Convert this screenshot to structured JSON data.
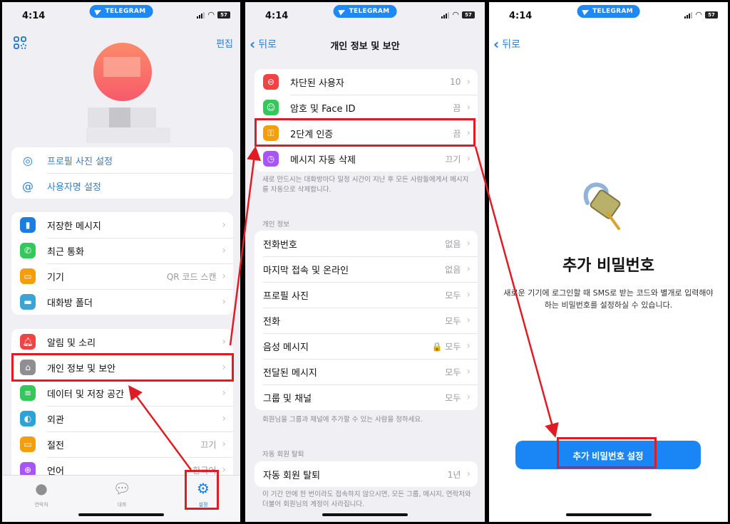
{
  "status_bar": {
    "time": "4:14",
    "pill_label": "TELEGRAM",
    "battery": "57"
  },
  "panel1": {
    "edit_label": "편집",
    "profile_actions": [
      {
        "icon": "camera-add-icon",
        "label": "프로필 사진 설정"
      },
      {
        "icon": "at-sign-add-icon",
        "label": "사용자명 설정"
      }
    ],
    "group1": [
      {
        "icon": "bookmark-icon",
        "color": "#1c7de0",
        "label": "저장한 메시지",
        "value": ""
      },
      {
        "icon": "phone-icon",
        "color": "#34c759",
        "label": "최근 통화",
        "value": ""
      },
      {
        "icon": "devices-icon",
        "color": "#f59e0b",
        "label": "기기",
        "value": "QR 코드 스캔"
      },
      {
        "icon": "folder-icon",
        "color": "#3aa3d8",
        "label": "대화방 폴더",
        "value": ""
      }
    ],
    "group2": [
      {
        "icon": "bell-icon",
        "color": "#ef4444",
        "label": "알림 및 소리",
        "value": ""
      },
      {
        "icon": "lock-icon",
        "color": "#8e8e93",
        "label": "개인 정보 및 보안",
        "value": ""
      },
      {
        "icon": "database-icon",
        "color": "#34c759",
        "label": "데이터 및 저장 공간",
        "value": ""
      },
      {
        "icon": "appearance-icon",
        "color": "#2aa3d8",
        "label": "외관",
        "value": ""
      },
      {
        "icon": "battery-icon",
        "color": "#f59e0b",
        "label": "절전",
        "value": "끄기"
      },
      {
        "icon": "globe-icon",
        "color": "#a855f7",
        "label": "언어",
        "value": "한국어"
      }
    ],
    "tabs": [
      {
        "icon": "contacts-icon",
        "label": "연락처",
        "active": false
      },
      {
        "icon": "chats-icon",
        "label": "대화",
        "active": false
      },
      {
        "icon": "settings-gear-icon",
        "label": "설정",
        "active": true
      }
    ]
  },
  "panel2": {
    "back_label": "뒤로",
    "title": "개인 정보 및 보안",
    "security": [
      {
        "icon": "blocked-icon",
        "color": "#ef4444",
        "label": "차단된 사용자",
        "value": "10"
      },
      {
        "icon": "faceid-icon",
        "color": "#34c759",
        "label": "암호 및 Face ID",
        "value": "끔"
      },
      {
        "icon": "key-icon",
        "color": "#f59e0b",
        "label": "2단계 인증",
        "value": "끔"
      },
      {
        "icon": "timer-icon",
        "color": "#a855f7",
        "label": "메시지 자동 삭제",
        "value": "끄기"
      }
    ],
    "security_caption": "새로 만드시는 대화방마다 일정 시간이 지난 후 모든 사람들에게서 메시지를 자동으로 삭제합니다.",
    "privacy_header": "개인 정보",
    "privacy": [
      {
        "label": "전화번호",
        "value": "없음"
      },
      {
        "label": "마지막 접속 및 온라인",
        "value": "없음"
      },
      {
        "label": "프로필 사진",
        "value": "모두"
      },
      {
        "label": "전화",
        "value": "모두"
      },
      {
        "label": "음성 메시지",
        "value": "🔒 모두"
      },
      {
        "label": "전달된 메시지",
        "value": "모두"
      },
      {
        "label": "그룹 및 채널",
        "value": "모두"
      }
    ],
    "privacy_caption": "회원님을 그룹과 채널에 추가할 수 있는 사람을 정하세요.",
    "auto_delete_header": "자동 회원 탈퇴",
    "auto_delete": [
      {
        "label": "자동 회원 탈퇴",
        "value": "1년"
      }
    ],
    "auto_delete_caption": "이 기간 안에 한 번이라도 접속하지 않으시면, 모든 그룹, 메시지, 연락처와 더불어 회원님의 계정이 사라집니다."
  },
  "panel3": {
    "back_label": "뒤로",
    "title": "추가 비밀번호",
    "description": "새로운 기기에 로그인할 때 SMS로 받는 코드와 별개로 입력해야 하는 비밀번호를 설정하실 수 있습니다.",
    "button_label": "추가 비밀번호 설정"
  },
  "annotation_color": "#e01b23"
}
